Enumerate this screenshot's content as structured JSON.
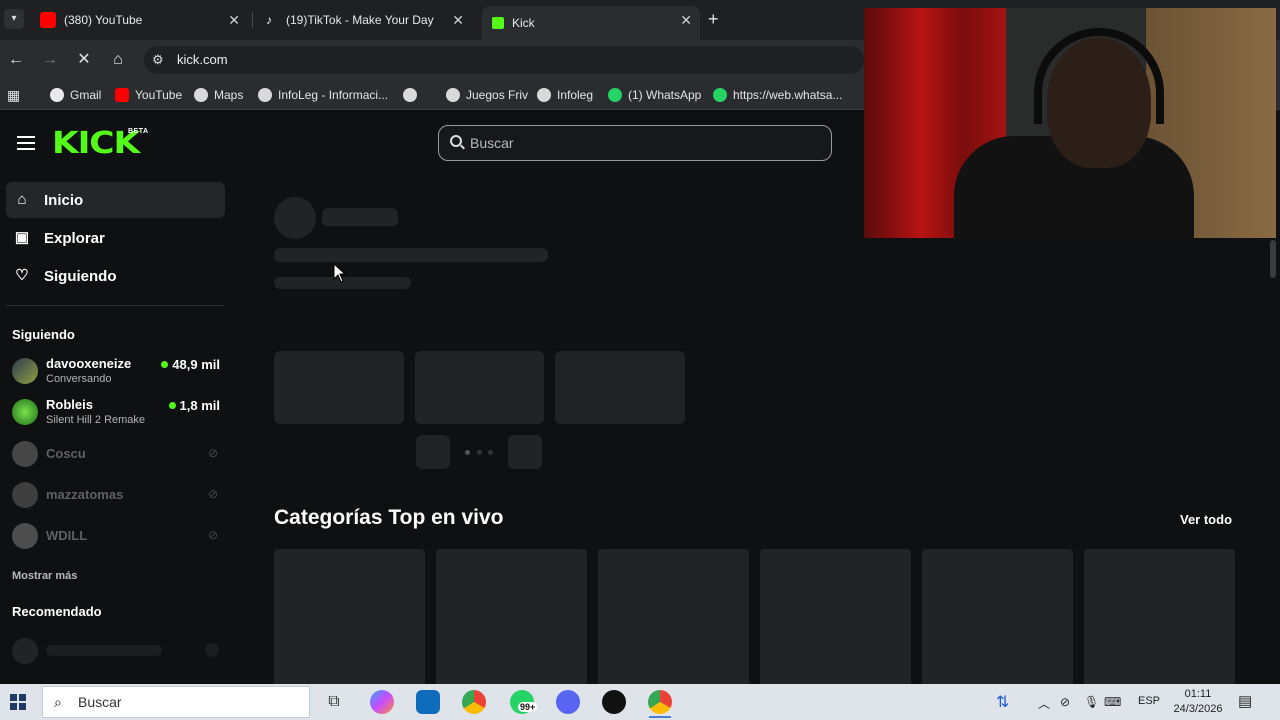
{
  "browser": {
    "tabs": [
      {
        "title": "(380) YouTube",
        "favicon": "youtube-icon"
      },
      {
        "title": "(19)TikTok - Make Your Day",
        "favicon": "tiktok-icon"
      },
      {
        "title": "Kick",
        "favicon": "kick-icon",
        "active": true
      }
    ],
    "url": "kick.com",
    "bookmarks": [
      {
        "label": "Gmail",
        "icon": "google-icon"
      },
      {
        "label": "YouTube",
        "icon": "youtube-icon"
      },
      {
        "label": "Maps",
        "icon": "globe-icon"
      },
      {
        "label": "InfoLeg - Informaci...",
        "icon": "globe-icon"
      },
      {
        "label": "",
        "icon": "globe-icon"
      },
      {
        "label": "Juegos Friv",
        "icon": "globe-icon"
      },
      {
        "label": "Infoleg",
        "icon": "globe-icon"
      },
      {
        "label": "(1) WhatsApp",
        "icon": "whatsapp-icon"
      },
      {
        "label": "https://web.whatsa...",
        "icon": "whatsapp-icon"
      }
    ]
  },
  "kick": {
    "logo": "KICK",
    "logo_badge": "BETA",
    "search_placeholder": "Buscar",
    "nav": [
      {
        "label": "Inicio",
        "icon": "home-icon"
      },
      {
        "label": "Explorar",
        "icon": "compass-icon"
      },
      {
        "label": "Siguiendo",
        "icon": "heart-icon"
      }
    ],
    "following_title": "Siguiendo",
    "following": [
      {
        "name": "davooxeneize",
        "category": "Conversando",
        "viewers": "48,9 mil",
        "live": true
      },
      {
        "name": "Robleis",
        "category": "Silent Hill 2 Remake",
        "viewers": "1,8 mil",
        "live": true
      },
      {
        "name": "Coscu",
        "live": false
      },
      {
        "name": "mazzatomas",
        "live": false
      },
      {
        "name": "WDILL",
        "live": false
      }
    ],
    "show_more": "Mostrar más",
    "recommended_title": "Recomendado",
    "categories_title": "Categorías Top en vivo",
    "see_all": "Ver todo",
    "accent_color": "#53fc18"
  },
  "taskbar": {
    "search_placeholder": "Buscar",
    "whatsapp_badge": "99+",
    "language": "ESP",
    "time": "01:11",
    "date": "24/3/2026"
  }
}
